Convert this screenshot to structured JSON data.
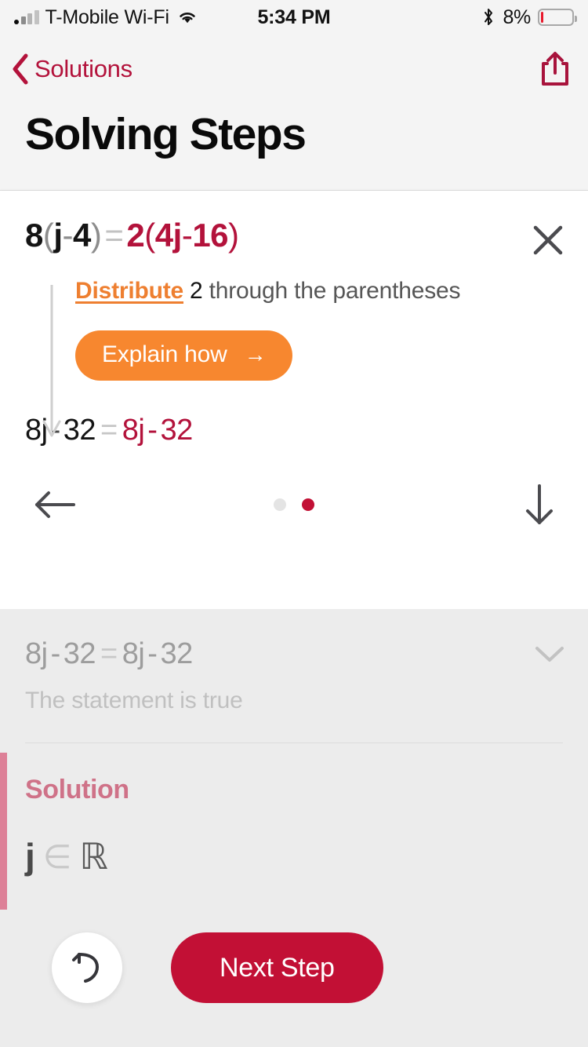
{
  "status_bar": {
    "carrier": "T-Mobile Wi-Fi",
    "time": "5:34 PM",
    "battery_percent": "8%",
    "battery_level": 8,
    "signal_icon": "signal-bars-icon",
    "wifi_icon": "wifi-icon",
    "bluetooth_icon": "bluetooth-icon",
    "battery_icon": "battery-icon",
    "battery_color": "#e8192c"
  },
  "nav": {
    "back_label": "Solutions",
    "back_icon": "chevron-left-icon",
    "share_icon": "share-icon",
    "accent_color": "#b3123b"
  },
  "header": {
    "title": "Solving Steps"
  },
  "step_card": {
    "equation": {
      "left_coefficient": "8",
      "left_open": "(",
      "left_var": "j",
      "left_minus": "-",
      "left_const": "4",
      "left_close": ")",
      "equals": "=",
      "right_coefficient": "2",
      "right_open": "(",
      "right_term": "4",
      "right_var": "j",
      "right_minus": "-",
      "right_const": "16",
      "right_close": ")",
      "full": "8(j - 4) = 2(4j - 16)"
    },
    "close_icon": "close-icon",
    "connector_icon": "down-arrow-connector-icon",
    "hint": {
      "link": "Distribute",
      "number": "2",
      "rest": " through the parentheses"
    },
    "explain_button": {
      "label": "Explain how",
      "arrow": "→",
      "color": "#f7872f"
    },
    "result": {
      "left": "8j",
      "left_minus": "-",
      "left_const": "32",
      "equals": "=",
      "right": "8j",
      "right_minus": "-",
      "right_const": "32",
      "full": "8j - 32 = 8j - 32"
    },
    "prev_icon": "arrow-left-icon",
    "next_icon": "arrow-down-icon",
    "pagination": {
      "total": 2,
      "active_index": 1,
      "active_color": "#c21035",
      "inactive_color": "#e4e4e4"
    }
  },
  "lower": {
    "prev_equation": {
      "left": "8j",
      "left_minus": "-",
      "left_const": "32",
      "equals": "=",
      "right": "8j",
      "right_minus": "-",
      "right_const": "32",
      "full": "8j - 32 = 8j - 32"
    },
    "expand_icon": "chevron-down-icon",
    "statement": "The statement is true",
    "solution": {
      "title": "Solution",
      "variable": "j",
      "member_symbol": "∈",
      "set_symbol": "ℝ",
      "full": "j ∈ ℝ",
      "bar_color": "#dd8097",
      "title_color": "#cf7288"
    }
  },
  "actions": {
    "undo_icon": "undo-icon",
    "next_step_label": "Next Step",
    "next_step_color": "#c21035"
  }
}
